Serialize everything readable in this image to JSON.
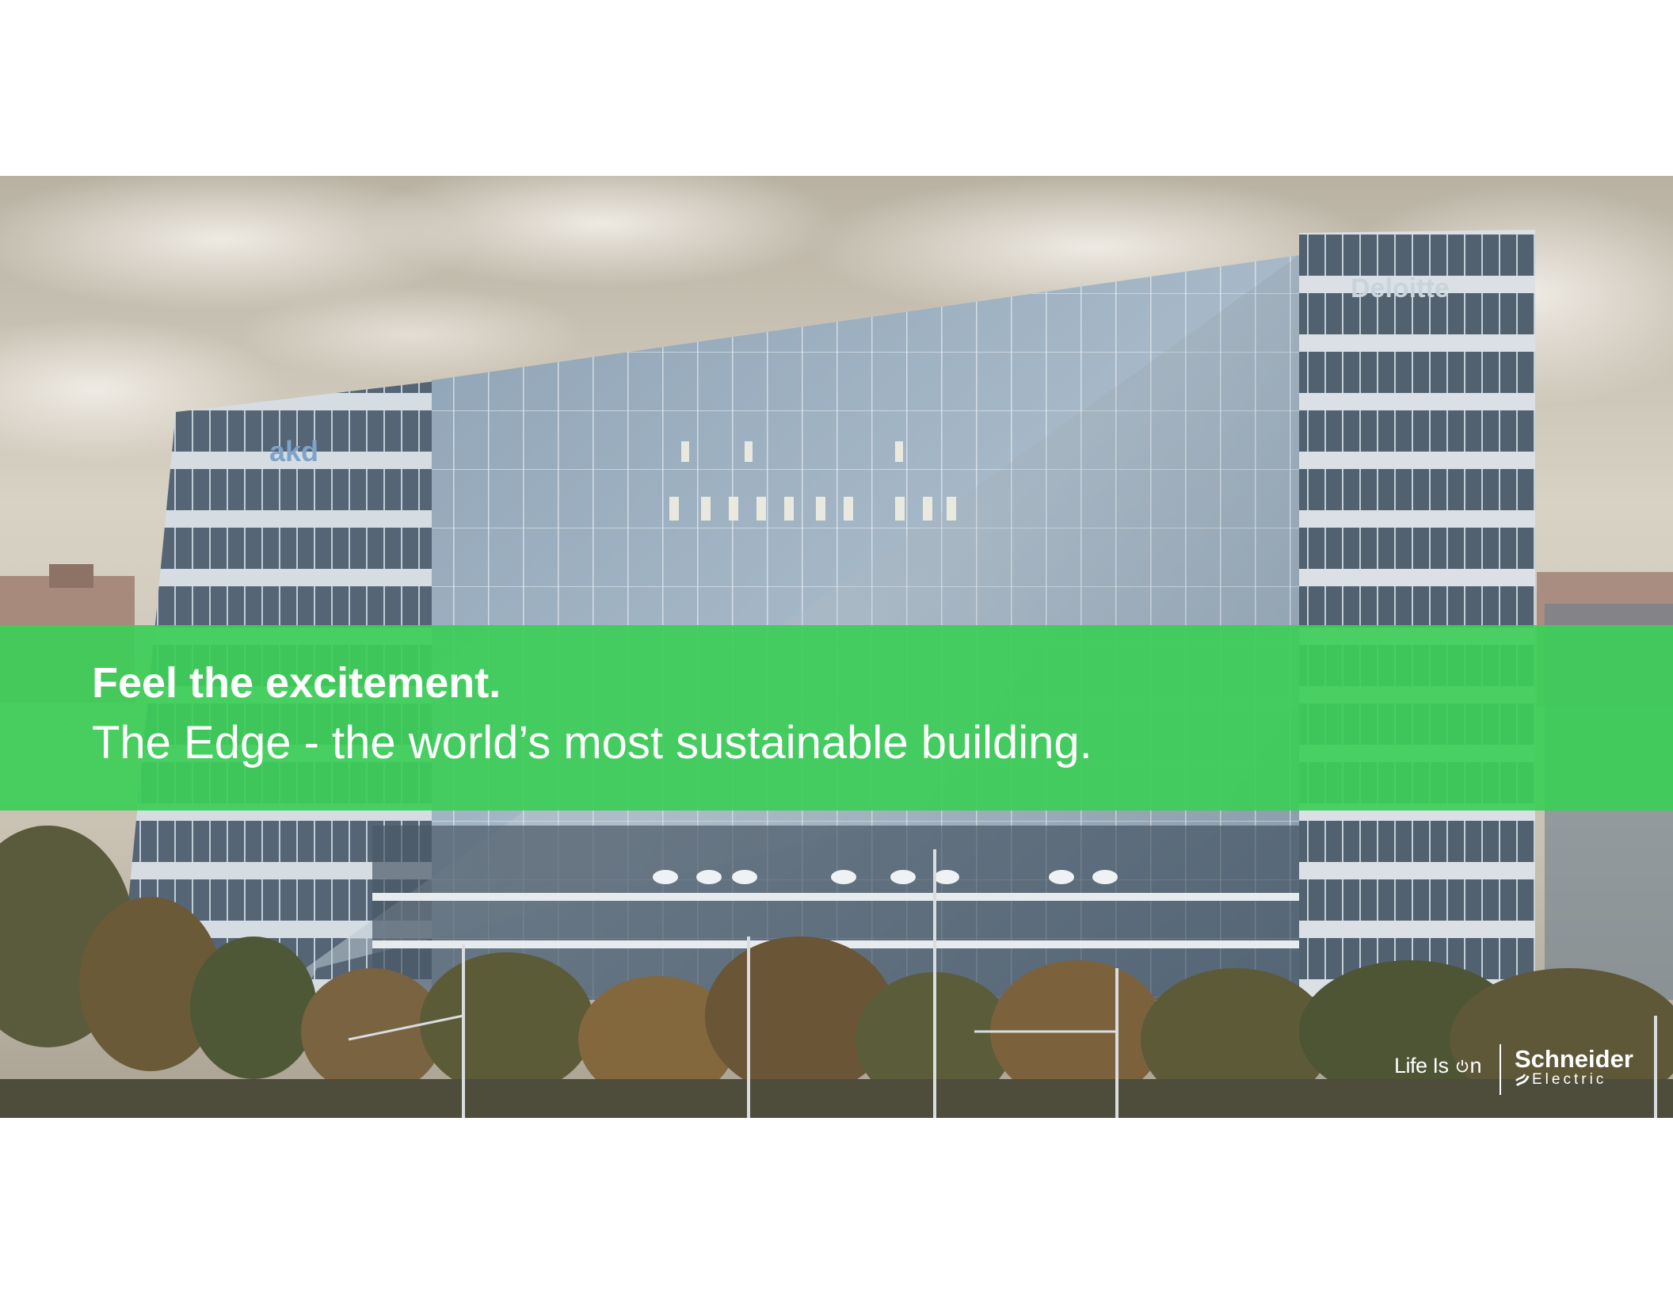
{
  "slide": {
    "headline": "Feel the excitement.",
    "subline": "The Edge - the world’s most sustainable building.",
    "accent_color": "#3DCD58"
  },
  "photo": {
    "building_sign_left": "akd",
    "building_sign_right": "Deloitte"
  },
  "brand": {
    "tagline_prefix": "Life Is ",
    "tagline_suffix": "n",
    "wordmark": "Schneider",
    "wordmark_sub": "Electric"
  }
}
